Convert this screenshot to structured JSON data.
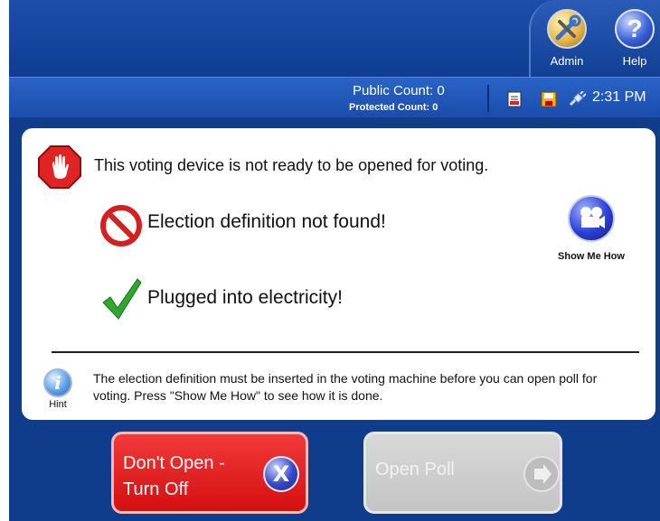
{
  "header": {
    "admin_label": "Admin",
    "help_label": "Help",
    "help_glyph": "?"
  },
  "status": {
    "public_count": "Public Count: 0",
    "protected_count": "Protected Count: 0",
    "time": "2:31 PM",
    "icons": [
      "report-icon",
      "save-icon",
      "power-plug-icon"
    ]
  },
  "panel": {
    "title": "This voting device is not ready to be opened for voting.",
    "error_item": "Election definition not found!",
    "ok_item": "Plugged into electricity!",
    "show_me_how": "Show Me How",
    "hint_label": "Hint",
    "hint_glyph": "i",
    "hint_text": "The election definition must be inserted in the voting machine before you can open poll for voting.  Press \"Show Me How\" to see how it is done."
  },
  "buttons": {
    "dont_open": "Don't Open - Turn Off",
    "dont_open_glyph": "X",
    "open_poll": "Open Poll",
    "open_poll_enabled": false
  },
  "colors": {
    "background": "#0f3d8c",
    "danger": "#e11d1d",
    "disabled": "#cccccc",
    "check": "#2fa82f"
  }
}
